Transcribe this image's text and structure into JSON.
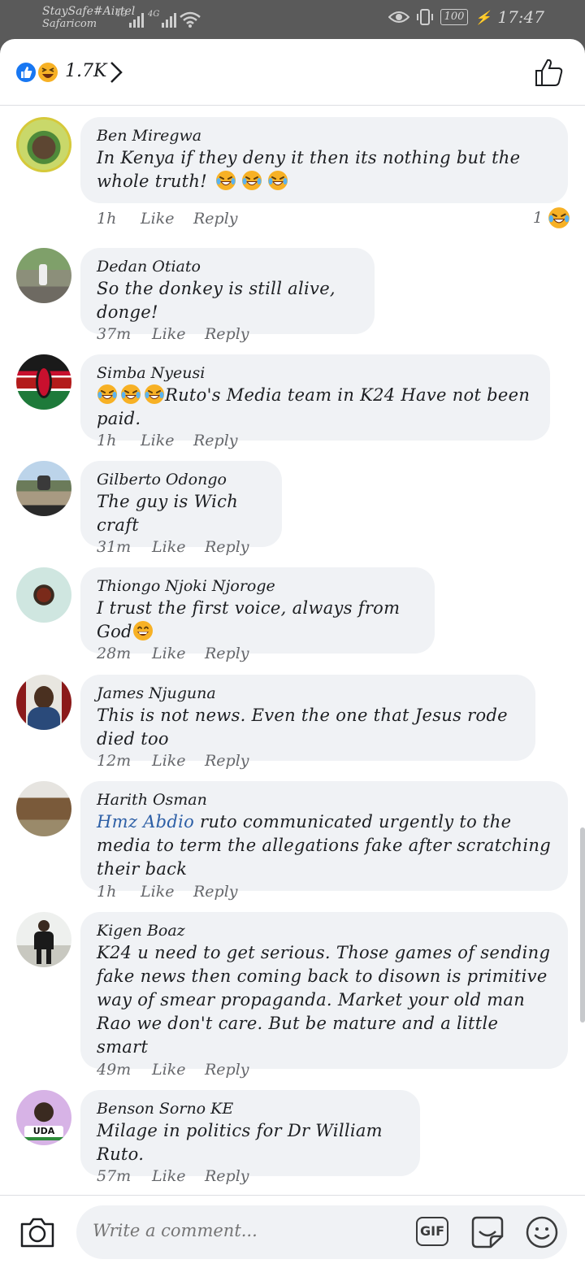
{
  "status": {
    "carrier_line1": "StaySafe#Airtel",
    "carrier_line2": "Safaricom",
    "net1": "4G",
    "net2": "4G",
    "battery": "100",
    "time": "17:47"
  },
  "header": {
    "reaction_count": "1.7K"
  },
  "comments": [
    {
      "author": "Ben Miregwa",
      "text": "In Kenya if they deny it then its nothing but the whole truth!",
      "time": "1h",
      "like": "Like",
      "reply": "Reply",
      "reaction_count": "1"
    },
    {
      "author": "Dedan Otiato",
      "text": "So the donkey is still alive, donge!",
      "time": "37m",
      "like": "Like",
      "reply": "Reply"
    },
    {
      "author": "Simba Nyeusi",
      "text": "Ruto's Media team in K24  Have not been paid.",
      "time": "1h",
      "like": "Like",
      "reply": "Reply"
    },
    {
      "author": "Gilberto Odongo",
      "text": "The guy is Wich craft",
      "time": "31m",
      "like": "Like",
      "reply": "Reply"
    },
    {
      "author": "Thiongo Njoki Njoroge",
      "text": "I trust the first voice, always from God",
      "time": "28m",
      "like": "Like",
      "reply": "Reply"
    },
    {
      "author": "James Njuguna",
      "text": "This is not news. Even the one that Jesus rode died too",
      "time": "12m",
      "like": "Like",
      "reply": "Reply"
    },
    {
      "author": "Harith Osman",
      "mention": "Hmz Abdio",
      "text": " ruto communicated urgently to the media to term the allegations fake after scratching their back",
      "time": "1h",
      "like": "Like",
      "reply": "Reply"
    },
    {
      "author": "Kigen Boaz",
      "text": "K24 u need to get serious. Those games of sending fake news then coming back to disown is primitive way of smear propaganda. Market your old man Rao we don't  care. But be mature and a little smart",
      "time": "49m",
      "like": "Like",
      "reply": "Reply"
    },
    {
      "author": "Benson Sorno KE",
      "text": "Milage in politics for Dr William Ruto.",
      "time": "57m",
      "like": "Like",
      "reply": "Reply",
      "avatar_text": "UDA"
    }
  ],
  "composer": {
    "placeholder": "Write a comment...",
    "gif_label": "GIF"
  },
  "icons": [
    "like-reaction-icon",
    "haha-reaction-icon",
    "chevron-right-icon",
    "thumbs-up-icon",
    "camera-icon",
    "gif-icon",
    "sticker-icon",
    "emoji-icon"
  ]
}
